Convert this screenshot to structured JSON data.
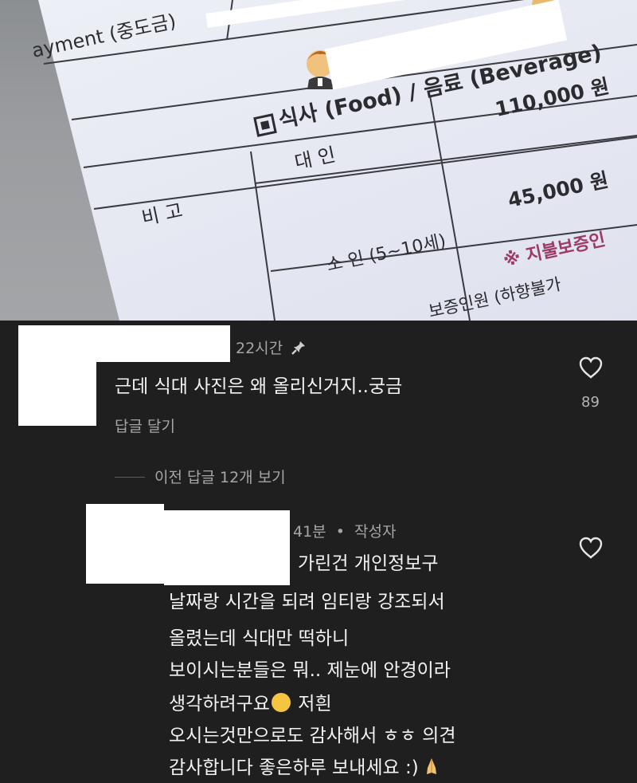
{
  "photo": {
    "payment_text": "ayment (중도금)",
    "food_label": "식사 (Food) / 음료 (Beverage)",
    "adult_label": "대 인",
    "adult_price": "110,000 원",
    "remark_label": "비 고",
    "child_label": "소 인 (5~10세)",
    "child_price": "45,000 원",
    "guarantee_note": "※ 지불보증인",
    "bottom_note": "보증인원 (하향불가"
  },
  "comment1": {
    "time": "22시간",
    "text": "근데 식대 사진은 왜 올리신거지..궁금",
    "reply_label": "답글 달기",
    "likes": "89"
  },
  "thread": {
    "view_replies": "이전 답글 12개 보기"
  },
  "comment2": {
    "time": "41분",
    "separator": "•",
    "author_badge": "작성자",
    "lines": [
      "가린건 개인정보구",
      "날짜랑 시간을 되려 임티랑 강조되서",
      "올렸는데 식대만 떡하니",
      "보이시는분들은 뭐.. 제눈에 안경이라",
      "생각하려구요",
      "저흰",
      "오시는것만으로도 감사해서 ㅎㅎ 의견",
      "감사합니다 좋은하루 보내세요 :)"
    ]
  },
  "icons": {
    "pin": "pin-icon",
    "heart": "heart-outline-icon",
    "laugh_emoji": "laughing-tears-emoji",
    "pray_emoji": "folded-hands-emoji"
  }
}
